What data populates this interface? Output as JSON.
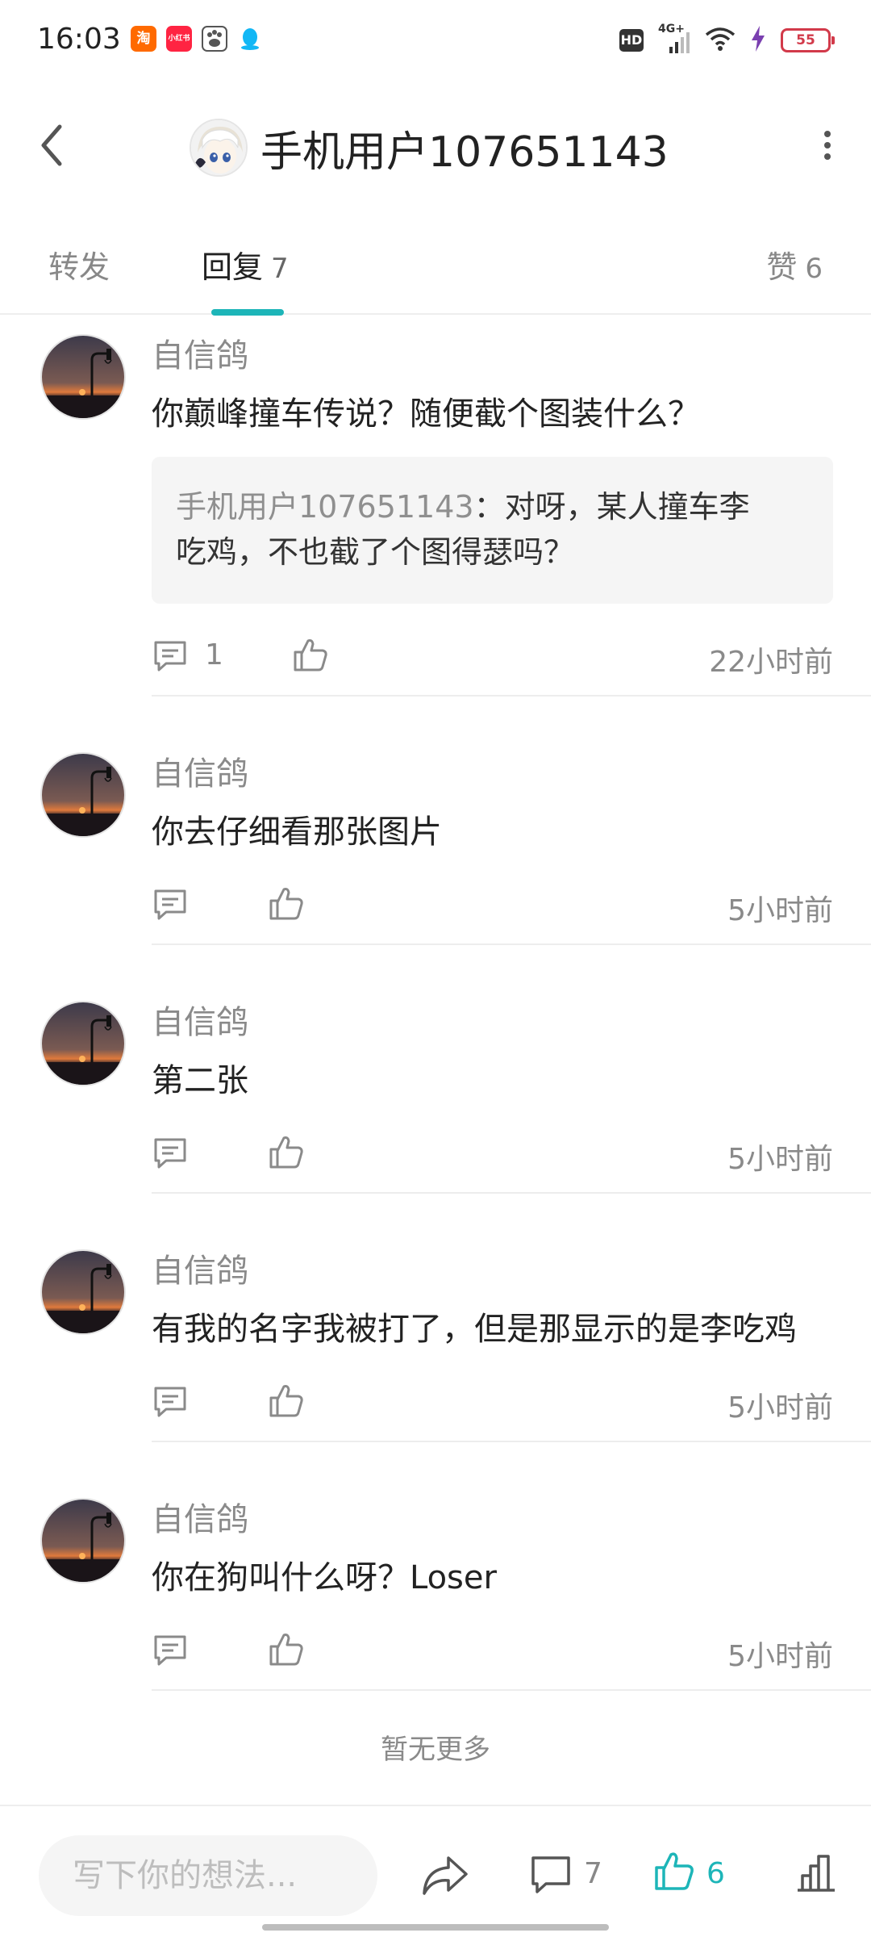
{
  "status_bar": {
    "time": "16:03",
    "apps": [
      {
        "label": "淘",
        "icon": "taobao-icon",
        "color": "#ff6a00"
      },
      {
        "label": "小红书",
        "icon": "xiaohongshu-icon",
        "color": "#ff2442"
      },
      {
        "label": "",
        "icon": "baidu-icon",
        "color": "#555555"
      },
      {
        "label": "",
        "icon": "qq-icon",
        "color": "#12b7f5"
      }
    ],
    "hd": "HD",
    "network": "4G+",
    "battery": "55"
  },
  "header": {
    "title": "手机用户107651143",
    "back_icon": "chevron-left-icon",
    "more_icon": "more-vertical-icon"
  },
  "tabs": [
    {
      "label": "转发",
      "count": ""
    },
    {
      "label": "回复",
      "count": "7"
    },
    {
      "label": "赞",
      "count": "6"
    }
  ],
  "accent_color": "#1db5b8",
  "comments": [
    {
      "user": "自信鸽",
      "text": "你巅峰撞车传说？随便截个图装什么？",
      "quote": {
        "user": "手机用户107651143",
        "text_line1": "对呀，某人撞车李",
        "text_line2": "吃鸡，不也截了个图得瑟吗？"
      },
      "reply_count": "1",
      "time": "22小时前"
    },
    {
      "user": "自信鸽",
      "text": "你去仔细看那张图片",
      "time": "5小时前"
    },
    {
      "user": "自信鸽",
      "text": "第二张",
      "time": "5小时前"
    },
    {
      "user": "自信鸽",
      "text": "有我的名字我被打了，但是那显示的是李吃鸡",
      "time": "5小时前"
    },
    {
      "user": "自信鸽",
      "text": "你在狗叫什么呀？Loser",
      "time": "5小时前"
    }
  ],
  "footer_note": "暂无更多",
  "bottom_bar": {
    "input_placeholder": "写下你的想法...",
    "comment_count": "7",
    "like_count": "6"
  }
}
